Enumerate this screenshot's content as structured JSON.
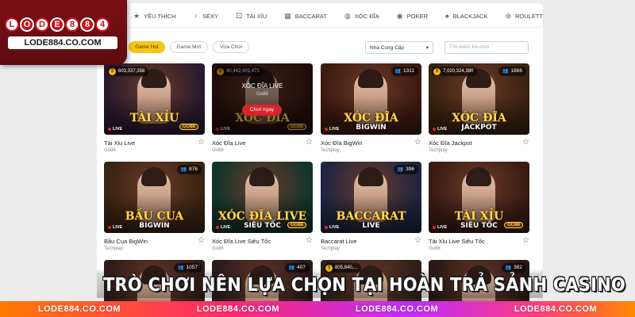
{
  "logo": {
    "letters": [
      "L",
      "O",
      "D",
      "E",
      "8",
      "8",
      "4"
    ],
    "url": "LODE884.CO.COM"
  },
  "category_nav": {
    "items": [
      {
        "icon": "heart-icon",
        "label": "YÊU THÍCH"
      },
      {
        "icon": "person-icon",
        "label": "SEXY"
      },
      {
        "icon": "dice-icon",
        "label": "TÀI XỈU"
      },
      {
        "icon": "cards-icon",
        "label": "BACCARAT"
      },
      {
        "icon": "disc-icon",
        "label": "XÓC ĐĨA"
      },
      {
        "icon": "chip-icon",
        "label": "POKER"
      },
      {
        "icon": "spade-icon",
        "label": "BLACKJACK"
      },
      {
        "icon": "roulette-icon",
        "label": "ROULETTI"
      }
    ]
  },
  "filters": {
    "pills": [
      "Game Hot",
      "Game Mới",
      "Vừa Chơi"
    ],
    "active_pill": "Game Hot",
    "provider_select": "Nhà Cung Cấp",
    "search_placeholder": "Tìm kiếm trò chơi"
  },
  "games": [
    {
      "name": "Tài Xỉu Live",
      "provider": "Go88",
      "badge": "603,337,358",
      "art_title": "TÀI XỈU",
      "art_sub": "",
      "brand": "GO88",
      "live": "LIVE",
      "bg": "#2a1a2e"
    },
    {
      "name": "Xóc Đĩa Live",
      "provider": "Go88",
      "badge": "40,442,401,473",
      "art_title": "XÓC ĐĨA",
      "art_sub": "",
      "brand": "GO88",
      "live": "LIVE",
      "bg": "#3a1816",
      "hover": true,
      "overlay_title": "XÓC ĐĨA LIVE",
      "overlay_provider": "Go88",
      "play": "Chơi ngay"
    },
    {
      "name": "Xóc Đĩa BigWin",
      "provider": "Techplay",
      "players": "1311",
      "art_title": "XÓC ĐĨA",
      "art_sub": "BIGWIN",
      "live": "LIVE",
      "bg": "#3d1a10"
    },
    {
      "name": "Xóc Đĩa Jackpot",
      "provider": "Techplay",
      "badge": "7,020,324,380",
      "players": "1866",
      "art_title": "XÓC ĐĨA",
      "art_sub": "JACKPOT",
      "live": "LIVE",
      "bg": "#3a2310"
    },
    {
      "name": "Bầu Cua BigWin",
      "provider": "Techplay",
      "players": "876",
      "art_title": "BẦU CUA",
      "art_sub": "BIGWIN",
      "live": "LIVE",
      "bg": "#3a2412"
    },
    {
      "name": "Xóc Đĩa Live Siêu Tốc",
      "provider": "Go88",
      "art_title": "XÓC ĐĨA LIVE",
      "art_sub": "SIÊU TỐC",
      "brand": "GO88",
      "live": "LIVE",
      "bg": "#12352a"
    },
    {
      "name": "Baccarat Live",
      "provider": "Techplay",
      "players": "396",
      "art_title": "BACCARAT",
      "art_sub": "LIVE",
      "live": "LIVE",
      "bg": "#1e2640"
    },
    {
      "name": "Tài Xỉu Live Siêu Tốc",
      "provider": "Go88",
      "art_title": "TÀI XỈU",
      "art_sub": "SIÊU TỐC",
      "brand": "GO88",
      "live": "LIVE",
      "bg": "#3a1c12"
    },
    {
      "name": "",
      "provider": "",
      "players": "1057",
      "bg": "#2e1c18"
    },
    {
      "name": "",
      "provider": "",
      "players": "407",
      "bg": "#2a1a1a"
    },
    {
      "name": "",
      "provider": "",
      "badge": "805,840,...",
      "bg": "#2e2018"
    },
    {
      "name": "",
      "provider": "",
      "players": "362",
      "bg": "#2a1814"
    }
  ],
  "caption": "TRÒ CHƠI NÊN LỰA CHỌN TẠI HOÀN TRẢ SẢNH CASINO",
  "bottom_stripe": [
    "LODE884.CO.COM",
    "LODE884.CO.COM",
    "LODE884.CO.COM",
    "LODE884.CO.COM"
  ]
}
